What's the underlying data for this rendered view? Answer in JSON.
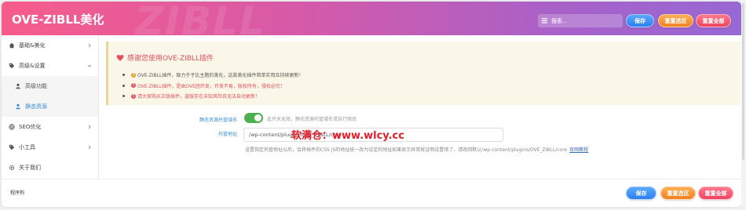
{
  "header": {
    "title": "OVE-ZIBLL美化",
    "watermark": "ZIBLL",
    "search_placeholder": "搜索...",
    "save_label": "保存",
    "reset_section_label": "重置选区",
    "reset_all_label": "重置全部"
  },
  "sidebar": {
    "items": [
      {
        "label": "基础&美化",
        "icon": "home-icon",
        "expandable": true
      },
      {
        "label": "高级&设置",
        "icon": "tag-icon",
        "expanded": true
      },
      {
        "label": "高级功能",
        "icon": "user-icon",
        "sub": true
      },
      {
        "label": "静态资源",
        "icon": "user-icon",
        "sub": true,
        "active": true
      },
      {
        "label": "SEO优化",
        "icon": "globe-icon",
        "expandable": true
      },
      {
        "label": "小工具",
        "icon": "tag-icon",
        "expandable": true
      },
      {
        "label": "关于我们",
        "icon": "gear-icon"
      }
    ]
  },
  "notice": {
    "title": "感谢您使用OVE-ZIBLL插件",
    "items": [
      "OVE-ZIBLL插件，致力于子比主题的美化，这款美化插件简单实用且持续更新！",
      "OVE-ZIBLL插件，是由OVE团开发，开发不易，版权所有，侵权必究！",
      "请大家购买正版插件，盗版存在未知风险且无法自动更新！"
    ]
  },
  "settings": {
    "cdn_label": "静态资源托管域名",
    "cdn_enabled": true,
    "cdn_desc": "此开关无效，静态资源托管域名请自行修改",
    "host_label": "托管地址",
    "host_value": "/wp-content/plugins/OVE_ZIBLL/core",
    "help_text": "设置指定托管地址以后，会将插件的CSS JS的地址统一改为设定的地址如果显示异常就证明设置错了，请改回默认/wp-content/plugins/OVE_ZIBLL/core",
    "help_link": "官网教程"
  },
  "overlay_text": "软满仓：www.wlcy.cc",
  "footer": {
    "left_text": "程序狗",
    "save_label": "保存",
    "reset_section_label": "重置选区",
    "reset_all_label": "重置全部"
  }
}
